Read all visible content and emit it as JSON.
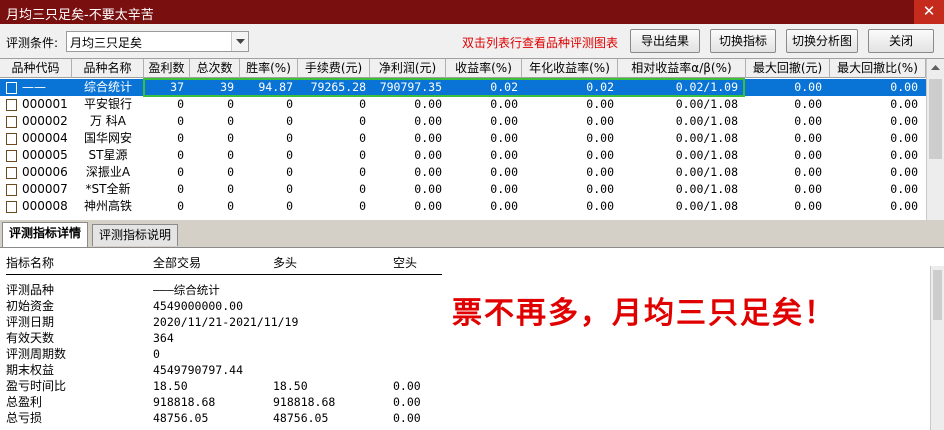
{
  "window": {
    "title": "月均三只足矣-不要太辛苦",
    "close_glyph": "✕"
  },
  "toolbar": {
    "condition_label": "评测条件:",
    "condition_value": "月均三只足矣",
    "hint": "双击列表行查看品种评测图表",
    "buttons": {
      "export": "导出结果",
      "switch_indicator": "切换指标",
      "switch_chart": "切换分析图",
      "close": "关闭"
    }
  },
  "grid": {
    "columns": [
      "品种代码",
      "品种名称",
      "盈利数",
      "总次数",
      "胜率(%)",
      "手续费(元)",
      "净利润(元)",
      "收益率(%)",
      "年化收益率(%)",
      "相对收益率α/β(%)",
      "最大回撤(元)",
      "最大回撤比(%)"
    ],
    "rows": [
      {
        "code": "——",
        "name": "综合统计",
        "win": "37",
        "total": "39",
        "rate": "94.87",
        "fee": "79265.28",
        "profit": "790797.35",
        "ret": "0.02",
        "annual": "0.02",
        "rel": "0.02/1.09",
        "dd": "0.00",
        "ddr": "0.00"
      },
      {
        "code": "000001",
        "name": "平安银行",
        "win": "0",
        "total": "0",
        "rate": "0",
        "fee": "0",
        "profit": "0.00",
        "ret": "0.00",
        "annual": "0.00",
        "rel": "0.00/1.08",
        "dd": "0.00",
        "ddr": "0.00"
      },
      {
        "code": "000002",
        "name": "万 科A",
        "win": "0",
        "total": "0",
        "rate": "0",
        "fee": "0",
        "profit": "0.00",
        "ret": "0.00",
        "annual": "0.00",
        "rel": "0.00/1.08",
        "dd": "0.00",
        "ddr": "0.00"
      },
      {
        "code": "000004",
        "name": "国华网安",
        "win": "0",
        "total": "0",
        "rate": "0",
        "fee": "0",
        "profit": "0.00",
        "ret": "0.00",
        "annual": "0.00",
        "rel": "0.00/1.08",
        "dd": "0.00",
        "ddr": "0.00"
      },
      {
        "code": "000005",
        "name": "ST星源",
        "win": "0",
        "total": "0",
        "rate": "0",
        "fee": "0",
        "profit": "0.00",
        "ret": "0.00",
        "annual": "0.00",
        "rel": "0.00/1.08",
        "dd": "0.00",
        "ddr": "0.00"
      },
      {
        "code": "000006",
        "name": "深振业A",
        "win": "0",
        "total": "0",
        "rate": "0",
        "fee": "0",
        "profit": "0.00",
        "ret": "0.00",
        "annual": "0.00",
        "rel": "0.00/1.08",
        "dd": "0.00",
        "ddr": "0.00"
      },
      {
        "code": "000007",
        "name": "*ST全新",
        "win": "0",
        "total": "0",
        "rate": "0",
        "fee": "0",
        "profit": "0.00",
        "ret": "0.00",
        "annual": "0.00",
        "rel": "0.00/1.08",
        "dd": "0.00",
        "ddr": "0.00"
      },
      {
        "code": "000008",
        "name": "神州高铁",
        "win": "0",
        "total": "0",
        "rate": "0",
        "fee": "0",
        "profit": "0.00",
        "ret": "0.00",
        "annual": "0.00",
        "rel": "0.00/1.08",
        "dd": "0.00",
        "ddr": "0.00"
      }
    ]
  },
  "tabs": {
    "details": "评测指标详情",
    "explain": "评测指标说明"
  },
  "details": {
    "headers": [
      "指标名称",
      "全部交易",
      "多头",
      "空头"
    ],
    "rows": [
      {
        "k": "评测品种",
        "v1": "———综合统计",
        "v2": "",
        "v3": ""
      },
      {
        "k": "初始资金",
        "v1": "4549000000.00",
        "v2": "",
        "v3": ""
      },
      {
        "k": "评测日期",
        "v1": "2020/11/21-2021/11/19",
        "v2": "",
        "v3": ""
      },
      {
        "k": "有效天数",
        "v1": "364",
        "v2": "",
        "v3": ""
      },
      {
        "k": "评测周期数",
        "v1": "0",
        "v2": "",
        "v3": ""
      },
      {
        "k": "期末权益",
        "v1": "4549790797.44",
        "v2": "",
        "v3": ""
      },
      {
        "k": "盈亏时间比",
        "v1": "18.50",
        "v2": "18.50",
        "v3": "0.00"
      },
      {
        "k": "总盈利",
        "v1": "918818.68",
        "v2": "918818.68",
        "v3": "0.00"
      },
      {
        "k": "总亏损",
        "v1": "48756.05",
        "v2": "48756.05",
        "v3": "0.00"
      }
    ],
    "slogan": "票不再多，月均三只足矣！"
  }
}
